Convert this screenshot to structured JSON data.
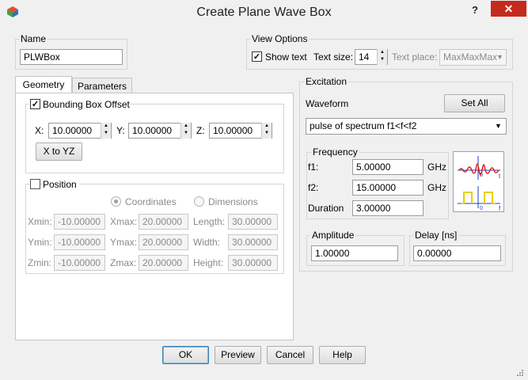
{
  "window": {
    "title": "Create Plane Wave Box",
    "help_glyph": "?",
    "close_glyph": "✕"
  },
  "name_group": {
    "label": "Name",
    "value": "PLWBox"
  },
  "view_options": {
    "label": "View Options",
    "show_text_label": "Show text",
    "show_text_checked": true,
    "text_size_label": "Text size:",
    "text_size_value": "14",
    "text_place_label": "Text place:",
    "text_place_value": "MaxMaxMax"
  },
  "tabs": [
    {
      "label": "Geometry"
    },
    {
      "label": "Parameters"
    }
  ],
  "bounding_box": {
    "label": "Bounding Box Offset",
    "checked": true,
    "x_label": "X:",
    "x_value": "10.00000",
    "y_label": "Y:",
    "y_value": "10.00000",
    "z_label": "Z:",
    "z_value": "10.00000",
    "x_to_yz_label": "X to YZ"
  },
  "position": {
    "label": "Position",
    "checked": false,
    "coordinates_label": "Coordinates",
    "dimensions_label": "Dimensions",
    "rows": [
      {
        "min_label": "Xmin:",
        "min_value": "-10.00000",
        "max_label": "Xmax:",
        "max_value": "20.00000",
        "dim_label": "Length:",
        "dim_value": "30.00000"
      },
      {
        "min_label": "Ymin:",
        "min_value": "-10.00000",
        "max_label": "Ymax:",
        "max_value": "20.00000",
        "dim_label": "Width:",
        "dim_value": "30.00000"
      },
      {
        "min_label": "Zmin:",
        "min_value": "-10.00000",
        "max_label": "Zmax:",
        "max_value": "20.00000",
        "dim_label": "Height:",
        "dim_value": "30.00000"
      }
    ]
  },
  "excitation": {
    "label": "Excitation",
    "waveform_label": "Waveform",
    "set_all_label": "Set All",
    "waveform_value": "pulse of spectrum f1<f<f2",
    "frequency": {
      "label": "Frequency",
      "f1_label": "f1:",
      "f1_value": "5.00000",
      "f1_unit": "GHz",
      "f2_label": "f2:",
      "f2_value": "15.00000",
      "f2_unit": "GHz",
      "duration_label": "Duration",
      "duration_value": "3.00000"
    },
    "amplitude_label": "Amplitude",
    "amplitude_value": "1.00000",
    "delay_label": "Delay [ns]",
    "delay_value": "0.00000"
  },
  "buttons": {
    "ok": "OK",
    "preview": "Preview",
    "cancel": "Cancel",
    "help": "Help"
  },
  "colors": {
    "close_red": "#c42b1c",
    "pulse_red": "#e02020",
    "spectrum_yellow": "#e8d000",
    "axis_blue": "#2040c0"
  }
}
